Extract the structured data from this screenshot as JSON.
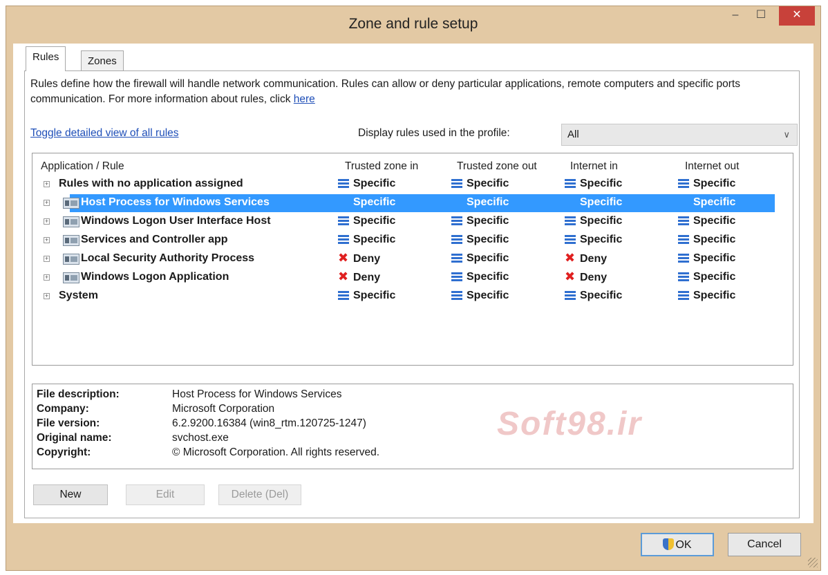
{
  "window": {
    "title": "Zone and rule setup",
    "min_glyph": "–",
    "max_glyph": "☐",
    "close_glyph": "✕"
  },
  "tabs": [
    {
      "label": "Rules",
      "active": true
    },
    {
      "label": "Zones",
      "active": false
    }
  ],
  "description": {
    "text": "Rules define how the firewall will handle network communication. Rules can allow or deny particular applications, remote computers and specific ports communication. For more information about rules, click ",
    "link": "here"
  },
  "toggle_link": "Toggle detailed view of all rules",
  "profile": {
    "label": "Display rules used in the profile:",
    "value": "All"
  },
  "columns": [
    "Application / Rule",
    "Trusted zone in",
    "Trusted zone out",
    "Internet in",
    "Internet out"
  ],
  "rules": [
    {
      "name": "Rules with no application assigned",
      "has_icon": false,
      "selected": false,
      "cells": [
        "Specific",
        "Specific",
        "Specific",
        "Specific"
      ],
      "icons": [
        "lines",
        "lines",
        "lines",
        "lines"
      ]
    },
    {
      "name": "Host Process for Windows Services",
      "has_icon": true,
      "selected": true,
      "cells": [
        "Specific",
        "Specific",
        "Specific",
        "Specific"
      ],
      "icons": [
        "none",
        "none",
        "none",
        "none"
      ]
    },
    {
      "name": "Windows Logon User Interface Host",
      "has_icon": true,
      "selected": false,
      "cells": [
        "Specific",
        "Specific",
        "Specific",
        "Specific"
      ],
      "icons": [
        "lines",
        "lines",
        "lines",
        "lines"
      ]
    },
    {
      "name": "Services and Controller app",
      "has_icon": true,
      "selected": false,
      "cells": [
        "Specific",
        "Specific",
        "Specific",
        "Specific"
      ],
      "icons": [
        "lines",
        "lines",
        "lines",
        "lines"
      ]
    },
    {
      "name": "Local Security Authority Process",
      "has_icon": true,
      "selected": false,
      "cells": [
        "Deny",
        "Specific",
        "Deny",
        "Specific"
      ],
      "icons": [
        "deny",
        "lines",
        "deny",
        "lines"
      ]
    },
    {
      "name": "Windows Logon Application",
      "has_icon": true,
      "selected": false,
      "cells": [
        "Deny",
        "Specific",
        "Deny",
        "Specific"
      ],
      "icons": [
        "deny",
        "lines",
        "deny",
        "lines"
      ]
    },
    {
      "name": "System",
      "has_icon": false,
      "selected": false,
      "cells": [
        "Specific",
        "Specific",
        "Specific",
        "Specific"
      ],
      "icons": [
        "lines",
        "lines",
        "lines",
        "lines"
      ]
    }
  ],
  "details": [
    {
      "label": "File description:",
      "value": "Host Process for Windows Services"
    },
    {
      "label": "Company:",
      "value": "Microsoft Corporation"
    },
    {
      "label": "File version:",
      "value": "6.2.9200.16384 (win8_rtm.120725-1247)"
    },
    {
      "label": "Original name:",
      "value": "svchost.exe"
    },
    {
      "label": "Copyright:",
      "value": "© Microsoft Corporation. All rights reserved."
    }
  ],
  "watermark": "Soft98.ir",
  "buttons": {
    "new": "New",
    "edit": "Edit",
    "delete": "Delete (Del)",
    "ok": "OK",
    "cancel": "Cancel"
  },
  "colors": {
    "selection": "#3399ff",
    "specific_icon": "#2f6fd0",
    "deny_icon": "#e02020",
    "close_button": "#c8413a",
    "link": "#1f4fb8"
  }
}
